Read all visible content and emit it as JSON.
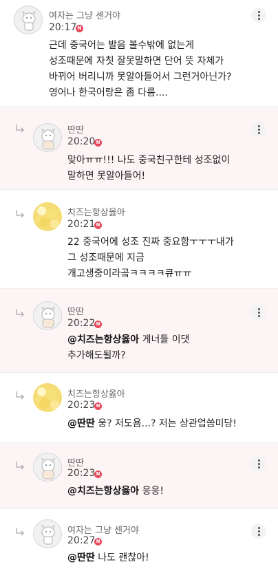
{
  "badge": "N",
  "comments": [
    {
      "author": "여자는 그냥 센거야",
      "time": "20:17",
      "lines": [
        "근데 중국어는 발음 볼수밖에 없는게",
        "성조때문에 자칫 잘못말하면 단어 뜻 자체가",
        "바뀌어 버리니까 못알아들어서 그런거아닌가?",
        "영어나 한국어랑은 좀 다름...."
      ]
    },
    {
      "author": "딴딴",
      "time": "20:20",
      "lines": [
        "맞아ㅠㅠ!!! 나도 중국친구한테 성조없이",
        "말하면 못알아들어!"
      ]
    },
    {
      "author": "치즈는항상옳아",
      "time": "20:21",
      "lines": [
        "22 중국어에 성조 진짜 중요함ㅜㅜㅜ내가",
        "그 성조때문에 지금",
        "개고생중이라곸ㅋㅋㅋㅋ큐ㅠㅠ"
      ]
    },
    {
      "author": "딴딴",
      "time": "20:22",
      "mention": "@치즈는항상옳아",
      "lines": [
        " 게너들 이댓",
        "추가해도될까?"
      ]
    },
    {
      "author": "치즈는항상옳아",
      "time": "20:23",
      "mention": "@딴딴",
      "lines": [
        " 웅?  저도욤...? 저는 상관업씀미당!"
      ]
    },
    {
      "author": "딴딴",
      "time": "20:23",
      "mention": "@치즈는항상옳아",
      "lines": [
        " 응응!"
      ]
    },
    {
      "author": "여자는 그냥 센거야",
      "time": "20:27",
      "mention": "@딴딴",
      "lines": [
        " 나도 괜찮아!"
      ]
    }
  ]
}
